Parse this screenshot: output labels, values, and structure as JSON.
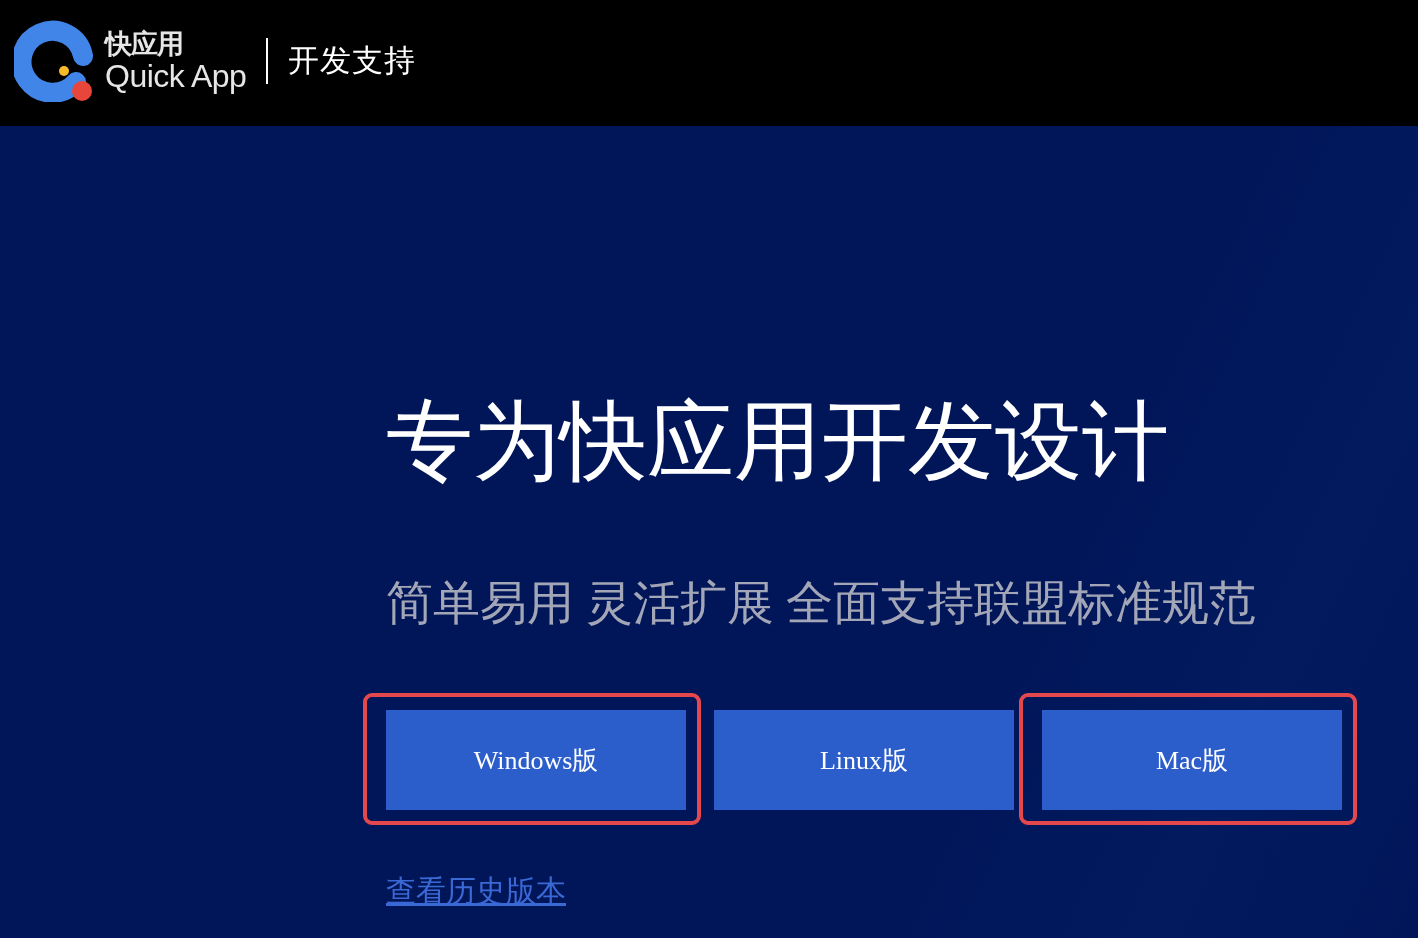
{
  "header": {
    "logo": {
      "name": "快应用",
      "subtitle": "Quick App"
    },
    "section": "开发支持"
  },
  "hero": {
    "title": "专为快应用开发设计",
    "subtitle": "简单易用 灵活扩展 全面支持联盟标准规范",
    "downloads": [
      {
        "label": "Windows版",
        "highlighted": true
      },
      {
        "label": "Linux版",
        "highlighted": false
      },
      {
        "label": "Mac版",
        "highlighted": true
      }
    ],
    "history_link": "查看历史版本"
  }
}
